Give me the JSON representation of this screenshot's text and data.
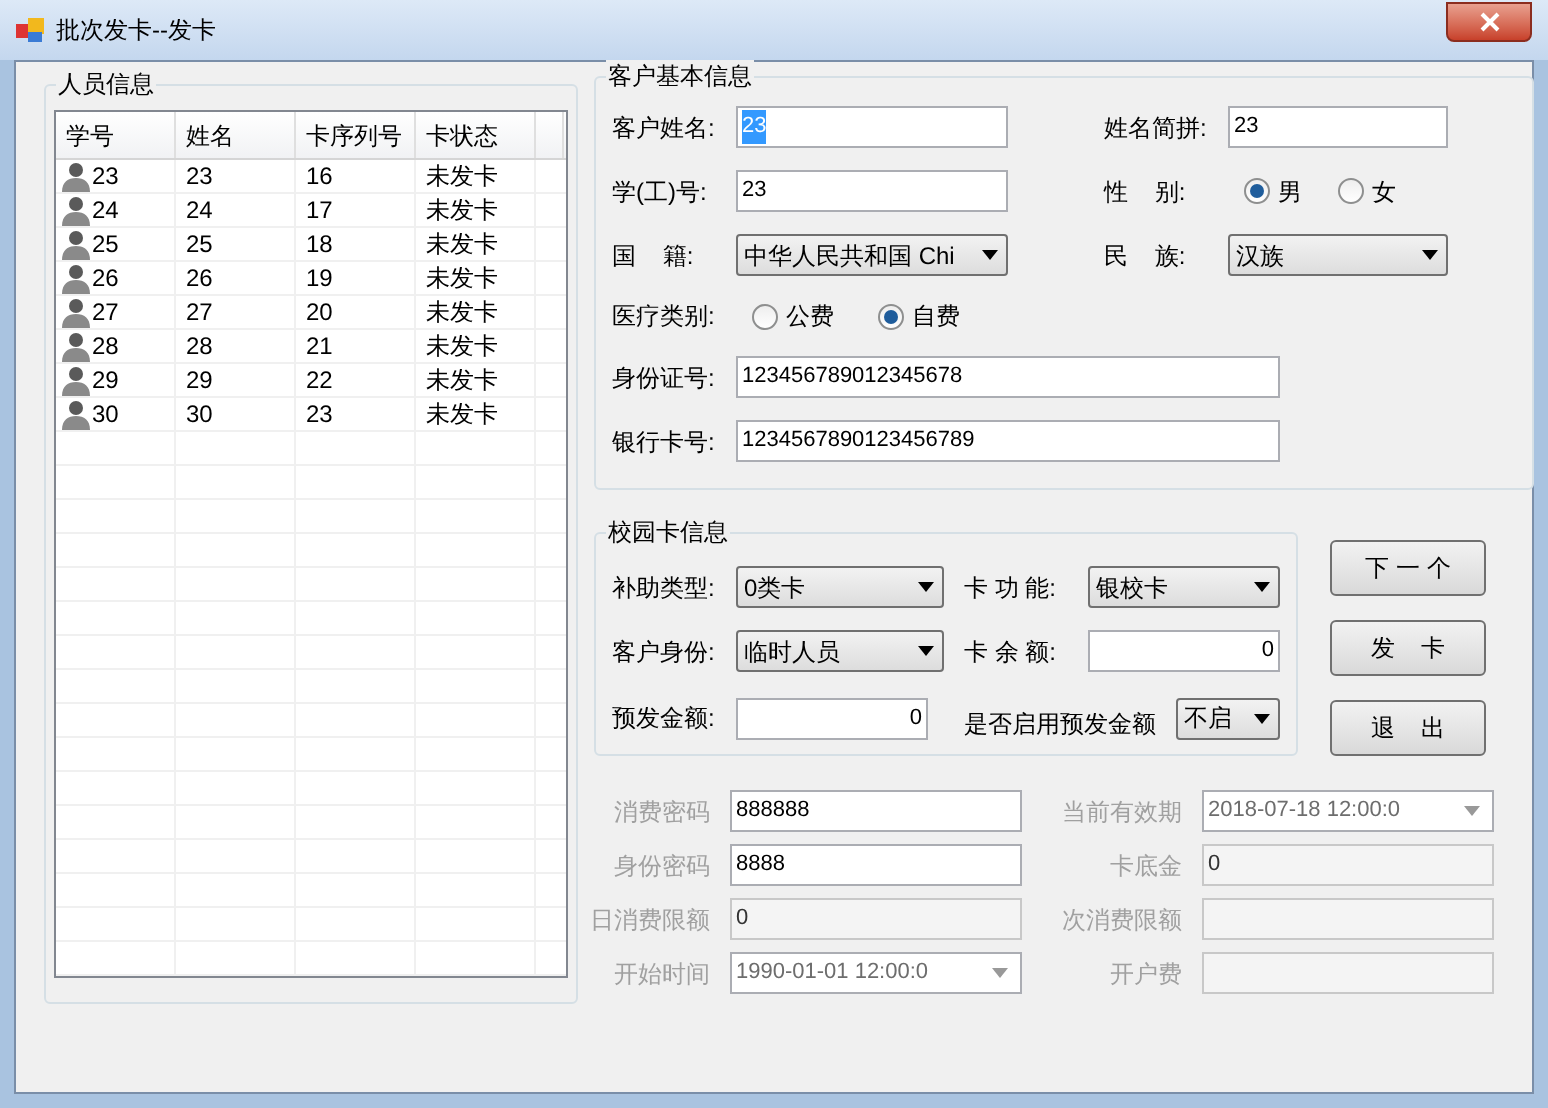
{
  "window": {
    "title": "批次发卡--发卡"
  },
  "person_info": {
    "title": "人员信息",
    "columns": [
      "学号",
      "姓名",
      "卡序列号",
      "卡状态"
    ],
    "rows": [
      {
        "cells": [
          "23",
          "23",
          "16",
          "未发卡"
        ]
      },
      {
        "cells": [
          "24",
          "24",
          "17",
          "未发卡"
        ]
      },
      {
        "cells": [
          "25",
          "25",
          "18",
          "未发卡"
        ]
      },
      {
        "cells": [
          "26",
          "26",
          "19",
          "未发卡"
        ]
      },
      {
        "cells": [
          "27",
          "27",
          "20",
          "未发卡"
        ]
      },
      {
        "cells": [
          "28",
          "28",
          "21",
          "未发卡"
        ]
      },
      {
        "cells": [
          "29",
          "29",
          "22",
          "未发卡"
        ]
      },
      {
        "cells": [
          "30",
          "30",
          "23",
          "未发卡"
        ]
      }
    ]
  },
  "basic_info": {
    "title": "客户基本信息",
    "name": {
      "label": "客户姓名:",
      "value": "23",
      "focused": true
    },
    "pinyin": {
      "label": "姓名简拼:",
      "value": "23"
    },
    "student_no": {
      "label": "学(工)号:",
      "value": "23"
    },
    "gender": {
      "label": "性    别:",
      "options": [
        {
          "label": "男",
          "selected": true
        },
        {
          "label": "女",
          "selected": false
        }
      ]
    },
    "nationality": {
      "label": "国    籍:",
      "value": "中华人民共和国 Chi"
    },
    "ethnicity": {
      "label": "民    族:",
      "value": "汉族"
    },
    "medical": {
      "label": "医疗类别:",
      "options": [
        {
          "label": "公费",
          "selected": false
        },
        {
          "label": "自费",
          "selected": true
        }
      ]
    },
    "id_card": {
      "label": "身份证号:",
      "value": "123456789012345678"
    },
    "bank_card": {
      "label": "银行卡号:",
      "value": "1234567890123456789"
    }
  },
  "campus_card": {
    "title": "校园卡信息",
    "subsidy_type": {
      "label": "补助类型:",
      "value": "0类卡"
    },
    "card_function": {
      "label": "卡 功 能:",
      "value": "银校卡"
    },
    "identity": {
      "label": "客户身份:",
      "value": "临时人员"
    },
    "balance": {
      "label": "卡 余 额:",
      "value": "0"
    },
    "prepay": {
      "label": "预发金额:",
      "value": "0"
    },
    "use_prepay": {
      "label": "是否启用预发金额",
      "value": "不启"
    }
  },
  "buttons": [
    "下 一 个",
    "发    卡",
    "退    出"
  ],
  "extra": [
    {
      "label": "消费密码",
      "value": "888888",
      "kind": "text",
      "disabled": false
    },
    {
      "label": "当前有效期",
      "value": "2018-07-18 12:00:0",
      "kind": "date",
      "disabled": true
    },
    {
      "label": "身份密码",
      "value": "8888",
      "kind": "text",
      "disabled": false
    },
    {
      "label": "卡底金",
      "value": "0",
      "kind": "text",
      "disabled": true
    },
    {
      "label": "日消费限额",
      "value": "0",
      "kind": "text",
      "disabled": true
    },
    {
      "label": "次消费限额",
      "kind": "text",
      "disabled": true
    },
    {
      "label": "开始时间",
      "value": "1990-01-01 12:00:0",
      "kind": "date",
      "disabled": true
    },
    {
      "label": "开户费",
      "kind": "text",
      "disabled": true
    }
  ]
}
